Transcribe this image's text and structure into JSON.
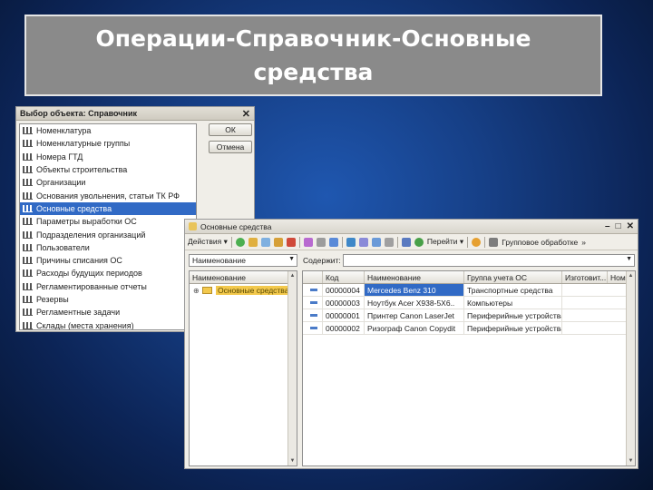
{
  "slide": {
    "title_line1": "Операции-Справочник-Основные",
    "title_line2": "средства"
  },
  "dialog": {
    "title": "Выбор объекта: Справочник",
    "close_glyph": "✕",
    "items": [
      "Номенклатура",
      "Номенклатурные группы",
      "Номера ГТД",
      "Объекты строительства",
      "Организации",
      "Основания увольнения, статьи ТК РФ",
      "Основные средства",
      "Параметры выработки ОС",
      "Подразделения организаций",
      "Пользователи",
      "Причины списания ОС",
      "Расходы будущих периодов",
      "Регламентированные отчеты",
      "Резервы",
      "Регламентные задачи",
      "Склады (места хранения)"
    ],
    "selected_index": 6,
    "ok_label": "ОК",
    "cancel_label": "Отмена"
  },
  "list_window": {
    "title": "Основные средства",
    "toolbar": {
      "actions_label": "Действия ▾",
      "goto_label": "Перейти ▾",
      "group_label": "Групповое обработке"
    },
    "filter": {
      "field_value": "Наименование",
      "search_label": "Содержит:"
    },
    "tree": {
      "header": "Наименование",
      "root_label": "Основные средства"
    },
    "table": {
      "columns": [
        "Код",
        "Наименование",
        "Группа учета ОС",
        "Изготовит...",
        "Номер"
      ],
      "rows": [
        [
          "00000004",
          "Mercedes Benz 310",
          "Транспортные средства"
        ],
        [
          "00000003",
          "Ноутбук Acer X938-5X6..",
          "Компьютеры"
        ],
        [
          "00000001",
          "Принтер Canon LaserJet",
          "Периферийные устройства"
        ],
        [
          "00000002",
          "Ризограф Canon Copydit",
          "Периферийные устройства"
        ]
      ],
      "highlight_row": 0
    }
  }
}
